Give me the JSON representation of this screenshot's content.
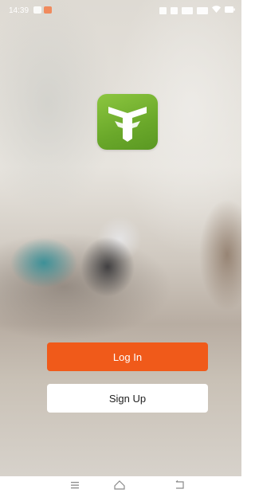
{
  "status_bar": {
    "time": "14:39",
    "icons": [
      "notification-icon",
      "message-icon",
      "hd-icon",
      "5g-signal-icon",
      "4g-signal-icon",
      "wifi-icon",
      "battery-icon"
    ]
  },
  "app": {
    "logo": "app-logo",
    "brand_color": "#8cc63f"
  },
  "buttons": {
    "login_label": "Log In",
    "login_color": "#f05a1a",
    "signup_label": "Sign Up"
  },
  "nav_bar": {
    "icons": [
      "menu-icon",
      "home-icon",
      "back-icon"
    ]
  }
}
